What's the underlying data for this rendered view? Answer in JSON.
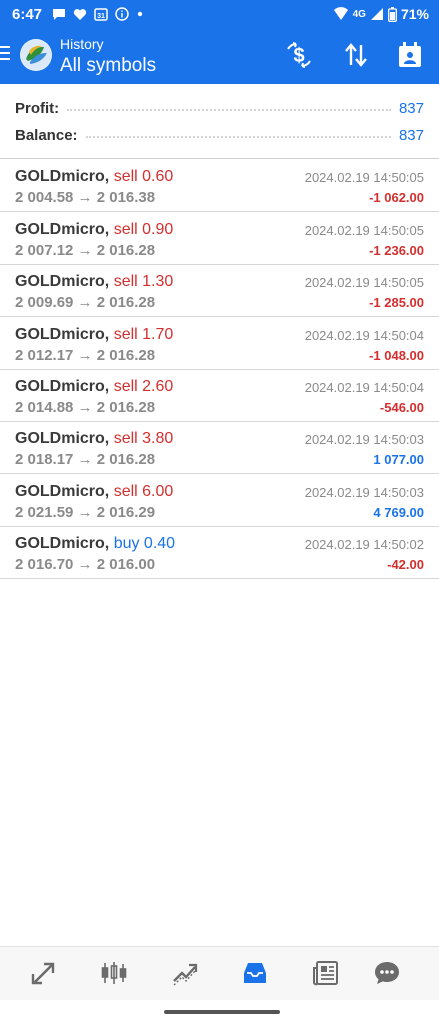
{
  "status": {
    "time": "6:47",
    "network": "4G",
    "battery": "71%",
    "icons": [
      "message-icon",
      "heart-icon",
      "calendar-icon",
      "info-icon",
      "dot-icon",
      "wifi-icon",
      "signal-icon",
      "battery-icon"
    ]
  },
  "header": {
    "subtitle": "History",
    "title": "All symbols",
    "actions": [
      "currency-exchange-icon",
      "sort-icon",
      "calendar-icon"
    ]
  },
  "summary": {
    "profit_label": "Profit:",
    "profit_value": "837",
    "balance_label": "Balance:",
    "balance_value": "837"
  },
  "deals": [
    {
      "symbol": "GOLDmicro,",
      "direction": "sell 0.60",
      "type": "sell",
      "prices": "2 004.58 → 2 016.38",
      "date": "2024.02.19 14:50:05",
      "profit": "-1 062.00",
      "profit_sign": "neg"
    },
    {
      "symbol": "GOLDmicro,",
      "direction": "sell 0.90",
      "type": "sell",
      "prices": "2 007.12 → 2 016.28",
      "date": "2024.02.19 14:50:05",
      "profit": "-1 236.00",
      "profit_sign": "neg"
    },
    {
      "symbol": "GOLDmicro,",
      "direction": "sell 1.30",
      "type": "sell",
      "prices": "2 009.69 → 2 016.28",
      "date": "2024.02.19 14:50:05",
      "profit": "-1 285.00",
      "profit_sign": "neg"
    },
    {
      "symbol": "GOLDmicro,",
      "direction": "sell 1.70",
      "type": "sell",
      "prices": "2 012.17 → 2 016.28",
      "date": "2024.02.19 14:50:04",
      "profit": "-1 048.00",
      "profit_sign": "neg"
    },
    {
      "symbol": "GOLDmicro,",
      "direction": "sell 2.60",
      "type": "sell",
      "prices": "2 014.88 → 2 016.28",
      "date": "2024.02.19 14:50:04",
      "profit": "-546.00",
      "profit_sign": "neg"
    },
    {
      "symbol": "GOLDmicro,",
      "direction": "sell 3.80",
      "type": "sell",
      "prices": "2 018.17 → 2 016.28",
      "date": "2024.02.19 14:50:03",
      "profit": "1 077.00",
      "profit_sign": "pos"
    },
    {
      "symbol": "GOLDmicro,",
      "direction": "sell 6.00",
      "type": "sell",
      "prices": "2 021.59 → 2 016.29",
      "date": "2024.02.19 14:50:03",
      "profit": "4 769.00",
      "profit_sign": "pos"
    },
    {
      "symbol": "GOLDmicro,",
      "direction": "buy 0.40",
      "type": "buy",
      "prices": "2 016.70 → 2 016.00",
      "date": "2024.02.19 14:50:02",
      "profit": "-42.00",
      "profit_sign": "neg"
    }
  ],
  "bottom_nav": [
    {
      "icon": "quotes-icon",
      "active": false
    },
    {
      "icon": "chart-icon",
      "active": false
    },
    {
      "icon": "trade-icon",
      "active": false
    },
    {
      "icon": "history-icon",
      "active": true
    },
    {
      "icon": "news-icon",
      "active": false
    },
    {
      "icon": "messages-icon",
      "active": false
    }
  ],
  "colors": {
    "accent": "#1a73e8",
    "negative": "#d32f2f",
    "muted": "#8a8a8a"
  }
}
